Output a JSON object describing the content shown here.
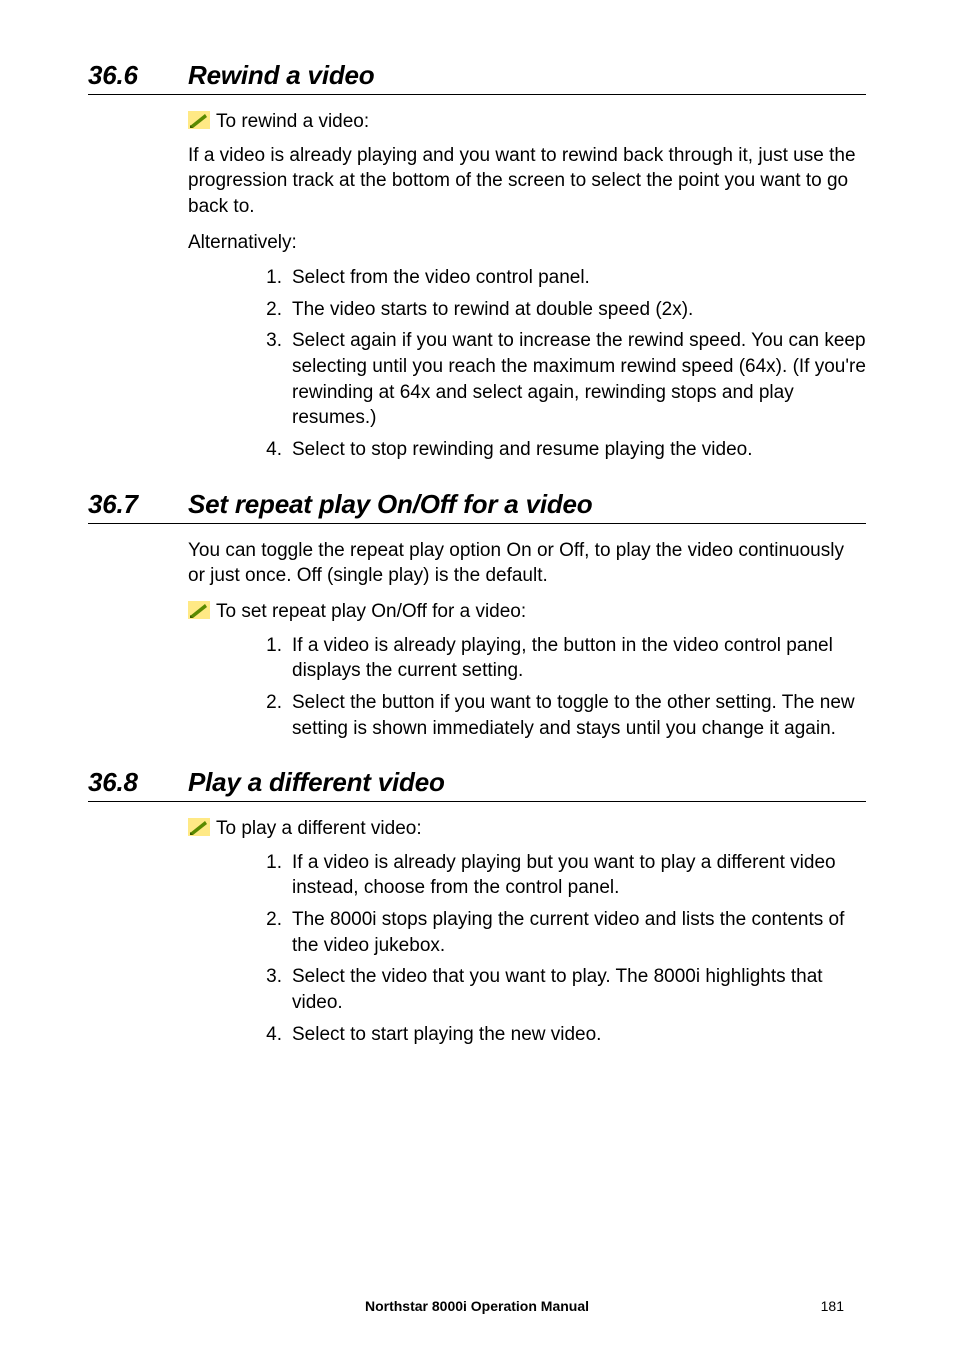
{
  "sections": {
    "s1": {
      "num": "36.6",
      "title": "Rewind a video",
      "pencil_label": "To rewind a video:",
      "para1": "If a video is already playing and you want to rewind back through it, just use the progression track at the bottom of the screen to select the point you want to go back to.",
      "para2": "Alternatively:",
      "items": {
        "n1": "1.",
        "c1": "Select                      from the video control panel.",
        "n2": "2.",
        "c2": "The video starts to rewind at double speed (2x).",
        "n3": "3.",
        "c3": "Select                       again if you want to increase the rewind speed. You can keep selecting                        until you reach the maximum rewind speed (64x). (If you're rewinding at 64x and select                       again, rewinding stops and play resumes.)",
        "n4": "4.",
        "c4": "Select                to stop rewinding and resume playing the video."
      }
    },
    "s2": {
      "num": "36.7",
      "title": "Set repeat play On/Off for a video",
      "para1": "You can toggle the repeat play option On or Off, to play the video continuously or just once. Off (single play) is the default.",
      "pencil_label": "To set repeat play On/Off for a video:",
      "items": {
        "n1": "1.",
        "c1": "If a video is already playing, the                     button in the video control panel displays the current setting.",
        "n2": "2.",
        "c2": "Select the button if you want to toggle to the other setting. The new setting is shown immediately and stays until you change it again."
      }
    },
    "s3": {
      "num": "36.8",
      "title": "Play a different video",
      "pencil_label": "To play a different video:",
      "items": {
        "n1": "1.",
        "c1": "If a video is already playing but you want to play a different video instead, choose                                  from the control panel.",
        "n2": "2.",
        "c2": "The 8000i stops playing the current video and lists the contents of the video jukebox.",
        "n3": "3.",
        "c3": "Select the video that you want to play. The 8000i highlights that video.",
        "n4": "4.",
        "c4": "Select                                             to start playing the new video."
      }
    }
  },
  "footer": {
    "title": "Northstar 8000i Operation Manual",
    "page": "181"
  }
}
